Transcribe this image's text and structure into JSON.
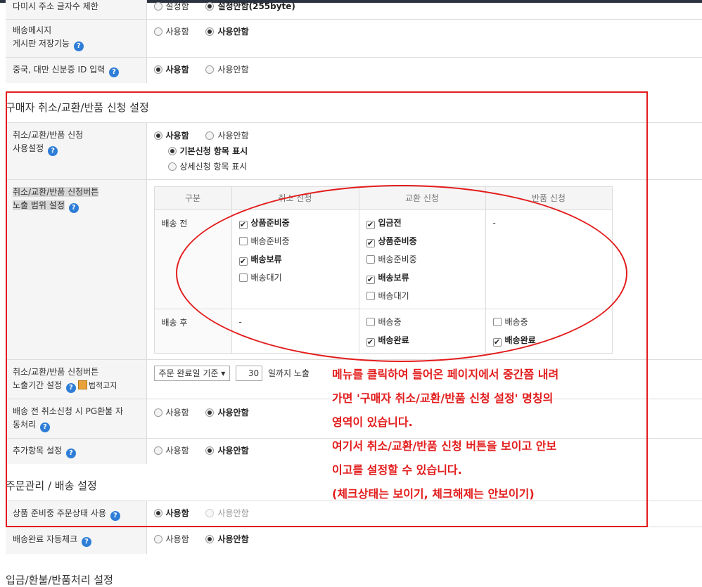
{
  "rows_top": [
    {
      "label": "다미시 주소 글자수 제한",
      "opt1": "설정함",
      "opt2": "설정안함(255byte)",
      "selected": 2
    },
    {
      "label_lines": [
        "배송메시지",
        "게시판 저장기능"
      ],
      "opt1": "사용함",
      "opt2": "사용안함",
      "selected": 2
    },
    {
      "label": "중국, 대만 신분증 ID 입력",
      "opt1": "사용함",
      "opt2": "사용안함",
      "selected": 1
    }
  ],
  "section1": {
    "title": "구매자 취소/교환/반품 신청 설정",
    "use_setting": {
      "label_lines": [
        "취소/교환/반품 신청",
        "사용설정"
      ],
      "opt1": "사용함",
      "opt2": "사용안함",
      "sub1": "기본신청 항목 표시",
      "sub2": "상세신청 항목 표시"
    },
    "expose_range": {
      "label_lines": [
        "취소/교환/반품 신청버튼",
        "노출 범위 설정"
      ],
      "headers": [
        "구분",
        "취소 신청",
        "교환 신청",
        "반품 신청"
      ],
      "before": {
        "label": "배송 전",
        "cancel": [
          {
            "text": "상품준비중",
            "checked": true
          },
          {
            "text": "배송준비중",
            "checked": false
          },
          {
            "text": "배송보류",
            "checked": true
          },
          {
            "text": "배송대기",
            "checked": false
          }
        ],
        "exchange": [
          {
            "text": "입금전",
            "checked": true
          },
          {
            "text": "상품준비중",
            "checked": true
          },
          {
            "text": "배송준비중",
            "checked": false
          },
          {
            "text": "배송보류",
            "checked": true
          },
          {
            "text": "배송대기",
            "checked": false
          }
        ],
        "return_text": "-"
      },
      "after": {
        "label": "배송 후",
        "cancel_text": "-",
        "exchange": [
          {
            "text": "배송중",
            "checked": false
          },
          {
            "text": "배송완료",
            "checked": true
          }
        ],
        "return": [
          {
            "text": "배송중",
            "checked": false
          },
          {
            "text": "배송완료",
            "checked": true
          }
        ]
      }
    },
    "expose_period": {
      "label_lines": [
        "취소/교환/반품 신청버튼",
        "노출기간 설정"
      ],
      "law_label": "법적고지",
      "select_value": "주문 완료일 기준",
      "days": "30",
      "suffix": "일까지 노출"
    },
    "pg_refund": {
      "label_lines": [
        "배송 전 취소신청 시 PG환불 자",
        "동처리"
      ],
      "opt1": "사용함",
      "opt2": "사용안함"
    },
    "extra_items": {
      "label": "추가항목 설정",
      "opt1": "사용함",
      "opt2": "사용안함"
    }
  },
  "section2": {
    "title": "주문관리 / 배송 설정",
    "prep_status": {
      "label": "상품 준비중 주문상태 사용",
      "opt1": "사용함",
      "opt2": "사용안함"
    },
    "auto_check": {
      "label": "배송완료 자동체크",
      "opt1": "사용함",
      "opt2": "사용안함"
    }
  },
  "section3": {
    "title": "입금/환불/반품처리 설정"
  },
  "annotation": {
    "lines": [
      "메뉴를 클릭하여 들어온 페이지에서 중간쯤 내려",
      "가면 '구매자 취소/교환/반품 신청 설정' 명칭의",
      "영역이 있습니다.",
      "여기서 취소/교환/반품 신청 버튼을 보이고 안보",
      "이고를 설정할 수 있습니다.",
      "(체크상태는 보이기, 체크해제는 안보이기)"
    ],
    "color": "#e31c1c"
  },
  "help_glyph": "?",
  "colors": {
    "help": "#2e7dd7",
    "highlight": "#e31c1c"
  }
}
